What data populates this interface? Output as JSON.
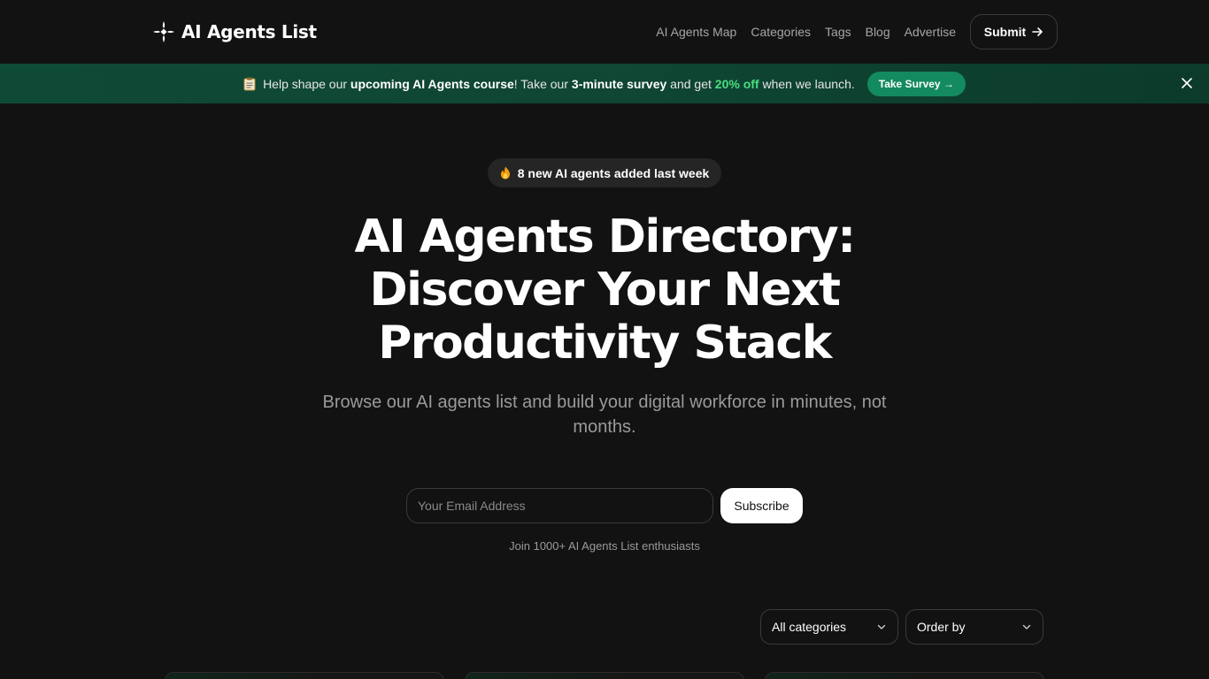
{
  "header": {
    "logo_text": "AI Agents List",
    "nav": [
      {
        "label": "AI Agents Map"
      },
      {
        "label": "Categories"
      },
      {
        "label": "Tags"
      },
      {
        "label": "Blog"
      },
      {
        "label": "Advertise"
      }
    ],
    "submit_label": "Submit"
  },
  "banner": {
    "icon": "clipboard-icon",
    "text_1": "Help shape our",
    "text_bold_1": "upcoming AI Agents course",
    "text_2": "! Take our",
    "text_bold_2": "3-minute survey",
    "text_3": "and get",
    "text_highlight": "20% off",
    "text_4": "when we launch.",
    "button_label": "Take Survey →",
    "accent": "#4ade80",
    "button_color": "#138a5f"
  },
  "hero": {
    "badge_icon": "fire-icon",
    "badge_text": "8 new AI agents added last week",
    "title_line_1": "AI Agents Directory:",
    "title_line_2": "Discover Your Next",
    "title_line_3": "Productivity Stack",
    "subtitle": "Browse our AI agents list and build your digital workforce in minutes, not months."
  },
  "subscribe": {
    "email_placeholder": "Your Email Address",
    "button_label": "Subscribe",
    "join_text": "Join 1000+ AI Agents List enthusiasts"
  },
  "filters": {
    "category_value": "All categories",
    "order_value": "Order by"
  }
}
